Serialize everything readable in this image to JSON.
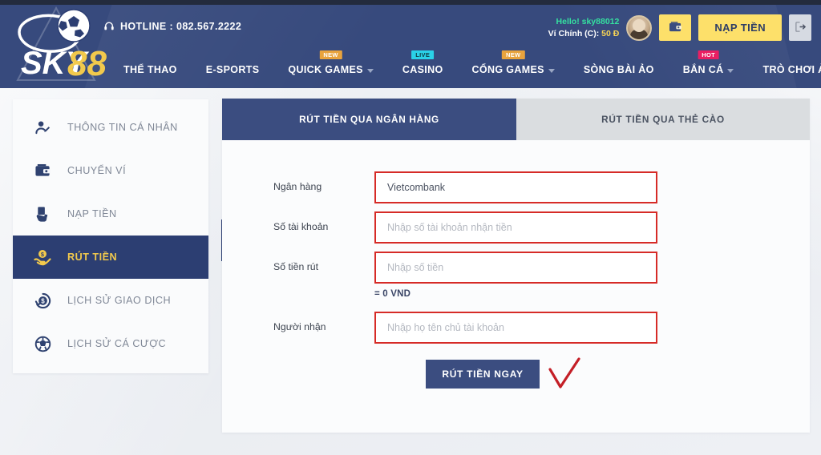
{
  "header": {
    "logo_text": "SKY88",
    "hotline_icon": "headset-icon",
    "hotline": "HOTLINE : 082.567.2222",
    "account": {
      "greeting": "Hello! sky88012",
      "wallet_label": "Ví Chính (C): ",
      "wallet_amount": "50 Đ",
      "avatar_name": "user-avatar",
      "wallet_button_icon": "wallet-icon",
      "deposit_button": "NẠP TIỀN",
      "logout_icon": "logout-icon"
    },
    "nav": [
      {
        "label": "THỂ THAO",
        "badge": null,
        "caret": false
      },
      {
        "label": "E-SPORTS",
        "badge": null,
        "caret": false
      },
      {
        "label": "QUICK GAMES",
        "badge": "NEW",
        "badge_type": "new",
        "caret": true
      },
      {
        "label": "CASINO",
        "badge": "LIVE",
        "badge_type": "live",
        "caret": false
      },
      {
        "label": "CỔNG GAMES",
        "badge": "NEW",
        "badge_type": "new",
        "caret": true
      },
      {
        "label": "SÒNG BÀI ẢO",
        "badge": null,
        "caret": false
      },
      {
        "label": "BẮN CÁ",
        "badge": "HOT",
        "badge_type": "hot",
        "caret": true
      },
      {
        "label": "TRÒ CHƠI ẢO",
        "badge": null,
        "caret": false
      }
    ]
  },
  "sidebar": {
    "items": [
      {
        "label": "THÔNG TIN CÁ NHÂN",
        "icon": "user-edit-icon",
        "active": false
      },
      {
        "label": "CHUYỂN VÍ",
        "icon": "wallet-icon",
        "active": false
      },
      {
        "label": "NẠP TIỀN",
        "icon": "hand-deposit-icon",
        "active": false
      },
      {
        "label": "RÚT TIỀN",
        "icon": "hand-coin-icon",
        "active": true
      },
      {
        "label": "LỊCH SỬ GIAO DỊCH",
        "icon": "refresh-dollar-icon",
        "active": false
      },
      {
        "label": "LỊCH SỬ CÁ CƯỢC",
        "icon": "soccer-ball-icon",
        "active": false
      }
    ]
  },
  "panel": {
    "tabs": [
      {
        "label": "RÚT TIỀN QUA NGÂN HÀNG",
        "active": true
      },
      {
        "label": "RÚT TIỀN QUA THẺ CÀO",
        "active": false
      }
    ],
    "form": {
      "rows": [
        {
          "label": "Ngân hàng",
          "value": "Vietcombank",
          "placeholder": ""
        },
        {
          "label": "Số tài khoản",
          "value": "",
          "placeholder": "Nhập số tài khoản nhận tiền"
        },
        {
          "label": "Số tiền rút",
          "value": "",
          "placeholder": "Nhập số tiền",
          "hint": "= 0 VND"
        },
        {
          "label": "Người nhận",
          "value": "",
          "placeholder": "Nhập họ tên chủ tài khoản"
        }
      ],
      "submit_label": "RÚT TIỀN NGAY",
      "annotation": "red-checkmark"
    }
  },
  "colors": {
    "header_navy": "#374a7d",
    "panel_navy": "#3b4d80",
    "sidebar_active": "#2c3e72",
    "accent_yellow": "#fde06a",
    "gold_text": "#f2c94c",
    "field_red": "#d62b27",
    "green_greeting": "#35e0a0",
    "badge_new": "#e8a33d",
    "badge_live": "#2ad2e8",
    "badge_hot": "#ea1f63",
    "page_bg": "#eef0f4"
  }
}
